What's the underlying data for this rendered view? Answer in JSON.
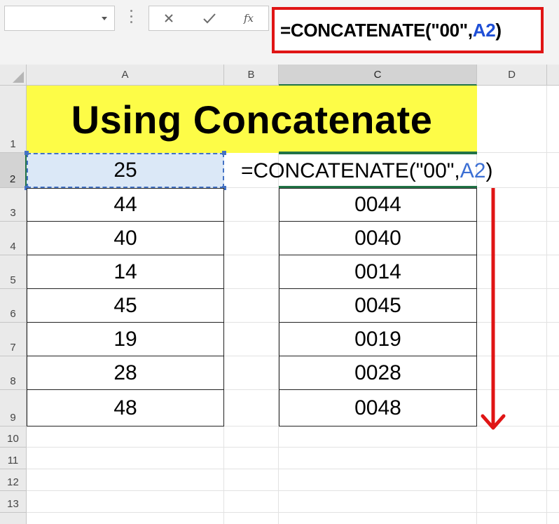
{
  "name_box": {
    "value": ""
  },
  "formula_bar": {
    "prefix": "=CONCATENATE(\"00\",",
    "ref": "A2",
    "suffix": ")",
    "fx_label": "fx"
  },
  "columns": [
    "A",
    "B",
    "C",
    "D"
  ],
  "rows": [
    "1",
    "2",
    "3",
    "4",
    "5",
    "6",
    "7",
    "8",
    "9",
    "10",
    "11",
    "12",
    "13"
  ],
  "title": "Using Concatenate",
  "column_a": [
    "25",
    "44",
    "40",
    "14",
    "45",
    "19",
    "28",
    "48"
  ],
  "column_c": [
    "0044",
    "0040",
    "0014",
    "0045",
    "0019",
    "0028",
    "0048"
  ],
  "cell_c2_formula": {
    "prefix": "=CONCATENATE(\"00\",",
    "ref": "A2",
    "suffix": ")"
  },
  "colors": {
    "highlight_border": "#e01515",
    "title_fill": "#fdfc47",
    "selection": "#217346",
    "reference": "#1f4fd6",
    "arrow": "#e01515"
  },
  "icons": [
    "cancel-icon",
    "enter-icon",
    "insert-function-icon",
    "dropdown-arrow-icon",
    "down-arrow-icon"
  ]
}
